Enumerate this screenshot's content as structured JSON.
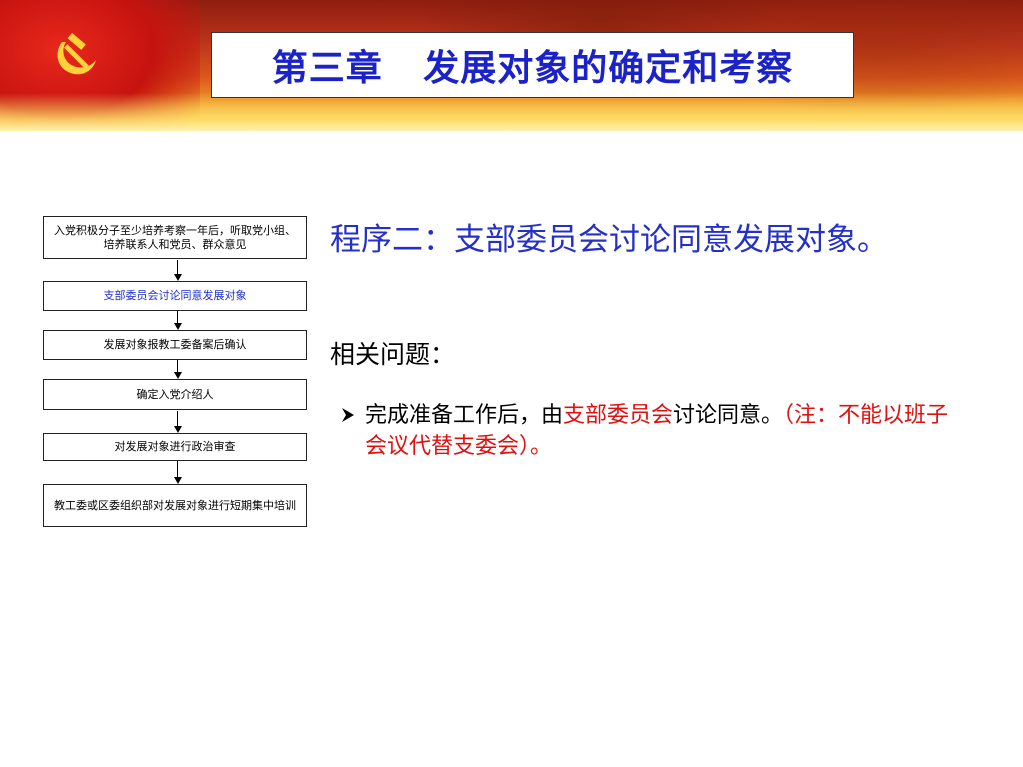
{
  "header": {
    "title": "第三章   发展对象的确定和考察"
  },
  "flowchart": {
    "steps": [
      "入党积极分子至少培养考察一年后，听取党小组、培养联系人和党员、群众意见",
      "支部委员会讨论同意发展对象",
      "发展对象报教工委备案后确认",
      "确定入党介绍人",
      "对发展对象进行政治审查",
      "教工委或区委组织部对发展对象进行短期集中培训"
    ],
    "highlight_color": "#1e2fd0"
  },
  "content": {
    "step_title": "程序二：支部委员会讨论同意发展对象。",
    "related_label": "相关问题：",
    "bullet": {
      "part1": "完成准备工作后，由",
      "part2_red": "支部委员会",
      "part3": "讨论同意。",
      "part4_red": "（注：不能以班子会议代替支委会）。"
    }
  },
  "colors": {
    "title_blue": "#1a22c8",
    "step_blue": "#2530c8",
    "note_red": "#e01010"
  },
  "icons": {
    "emblem": "hammer-sickle-icon",
    "bullet": "arrow-bullet-icon",
    "flow_arrow": "arrow-down-icon"
  }
}
